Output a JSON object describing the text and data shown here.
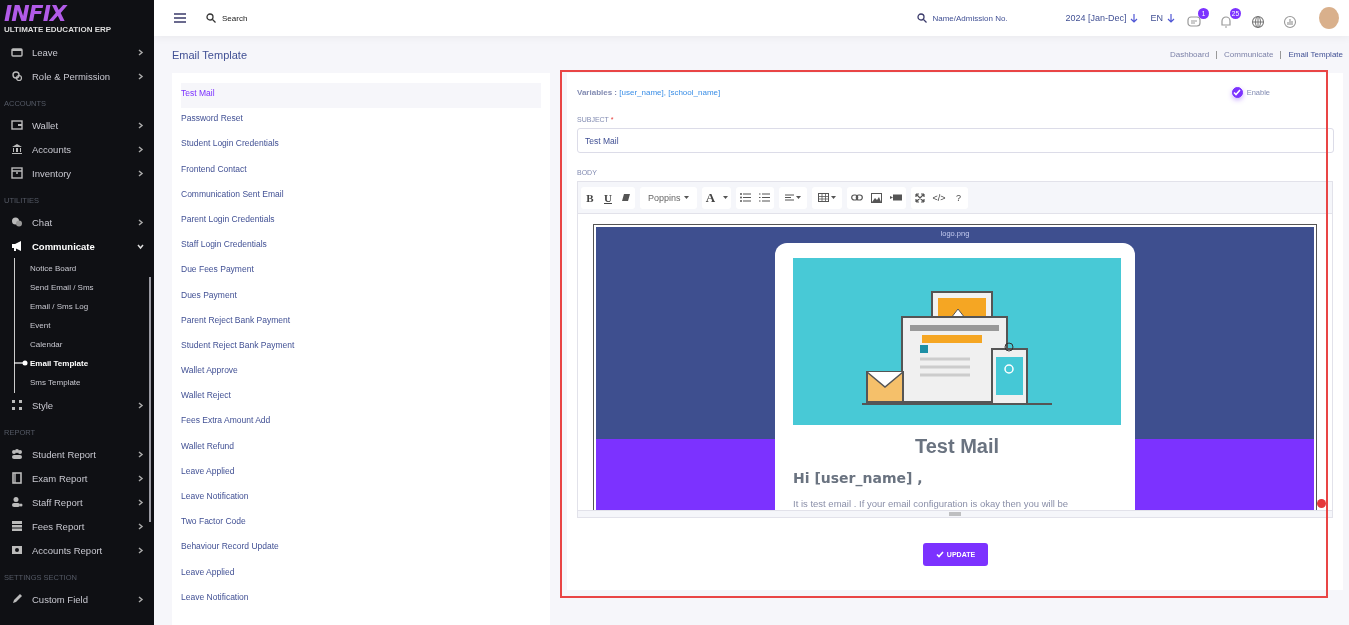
{
  "sidebar": {
    "logo": {
      "title": "INFIX",
      "subtitle": "ULTIMATE EDUCATION ERP"
    },
    "items": [
      {
        "kind": "item",
        "label": "Leave",
        "expanded": false
      },
      {
        "kind": "item",
        "label": "Role & Permission",
        "expanded": false
      },
      {
        "kind": "section",
        "label": "ACCOUNTS"
      },
      {
        "kind": "item",
        "label": "Wallet",
        "expanded": false
      },
      {
        "kind": "item",
        "label": "Accounts",
        "expanded": false
      },
      {
        "kind": "item",
        "label": "Inventory",
        "expanded": false
      },
      {
        "kind": "section",
        "label": "UTILITIES"
      },
      {
        "kind": "item",
        "label": "Chat",
        "expanded": false
      },
      {
        "kind": "item",
        "label": "Communicate",
        "expanded": true,
        "children": [
          {
            "label": "Notice Board",
            "selected": false
          },
          {
            "label": "Send Email / Sms",
            "selected": false
          },
          {
            "label": "Email / Sms Log",
            "selected": false
          },
          {
            "label": "Event",
            "selected": false
          },
          {
            "label": "Calendar",
            "selected": false
          },
          {
            "label": "Email Template",
            "selected": true
          },
          {
            "label": "Sms Template",
            "selected": false
          }
        ]
      },
      {
        "kind": "item",
        "label": "Style",
        "expanded": false
      },
      {
        "kind": "section",
        "label": "REPORT"
      },
      {
        "kind": "item",
        "label": "Student Report",
        "expanded": false
      },
      {
        "kind": "item",
        "label": "Exam Report",
        "expanded": false
      },
      {
        "kind": "item",
        "label": "Staff Report",
        "expanded": false
      },
      {
        "kind": "item",
        "label": "Fees Report",
        "expanded": false
      },
      {
        "kind": "item",
        "label": "Accounts Report",
        "expanded": false
      },
      {
        "kind": "section",
        "label": "SETTINGS SECTION"
      },
      {
        "kind": "item",
        "label": "Custom Field",
        "expanded": false
      }
    ]
  },
  "topbar": {
    "search": {
      "placeholder": "Search"
    },
    "student_search": {
      "placeholder": "Name/Admission No."
    },
    "session": "2024 [Jan-Dec]",
    "language": "EN",
    "message_count": "1",
    "notification_count": "25"
  },
  "page_title": "Email Template",
  "breadcrumb": [
    "Dashboard",
    "Communicate",
    "Email Template"
  ],
  "templates": [
    {
      "label": "Test Mail",
      "selected": true
    },
    {
      "label": "Password Reset",
      "selected": false
    },
    {
      "label": "Student Login Credentials",
      "selected": false
    },
    {
      "label": "Frontend Contact",
      "selected": false
    },
    {
      "label": "Communication Sent Email",
      "selected": false
    },
    {
      "label": "Parent Login Credentials",
      "selected": false
    },
    {
      "label": "Staff Login Credentials",
      "selected": false
    },
    {
      "label": "Due Fees Payment",
      "selected": false
    },
    {
      "label": "Dues Payment",
      "selected": false
    },
    {
      "label": "Parent Reject Bank Payment",
      "selected": false
    },
    {
      "label": "Student Reject Bank Payment",
      "selected": false
    },
    {
      "label": "Wallet Approve",
      "selected": false
    },
    {
      "label": "Wallet Reject",
      "selected": false
    },
    {
      "label": "Fees Extra Amount Add",
      "selected": false
    },
    {
      "label": "Wallet Refund",
      "selected": false
    },
    {
      "label": "Leave Applied",
      "selected": false
    },
    {
      "label": "Leave Notification",
      "selected": false
    },
    {
      "label": "Two Factor Code",
      "selected": false
    },
    {
      "label": "Behaviour Record Update",
      "selected": false
    },
    {
      "label": "Leave Applied",
      "selected": false
    },
    {
      "label": "Leave Notification",
      "selected": false
    }
  ],
  "form": {
    "variables_label": "Variables :",
    "variables": "[user_name], [school_name]",
    "enable": {
      "label": "Enable",
      "checked": true
    },
    "subject_label": "SUBJECT",
    "required_mark": "*",
    "subject": "Test Mail",
    "body_label": "BODY",
    "toolbar": [
      [
        {
          "kind": "text",
          "label": "B"
        },
        {
          "kind": "text",
          "label": "U"
        },
        {
          "kind": "icon"
        }
      ],
      [
        {
          "kind": "dropdown",
          "label": "Poppins"
        }
      ],
      [
        {
          "kind": "text",
          "label": "A"
        },
        {
          "kind": "caret"
        }
      ],
      [
        {
          "kind": "icon"
        },
        {
          "kind": "icon"
        }
      ],
      [
        {
          "kind": "icondrop"
        }
      ],
      [
        {
          "kind": "icondrop"
        }
      ],
      [
        {
          "kind": "icon"
        },
        {
          "kind": "icon"
        },
        {
          "kind": "icon"
        }
      ],
      [
        {
          "kind": "icon"
        },
        {
          "kind": "text",
          "label": "</>"
        },
        {
          "kind": "text",
          "label": "?"
        }
      ]
    ],
    "preview": {
      "logo_alt": "logo.png",
      "heading": "Test Mail",
      "greeting": "Hi [user_name] ,",
      "body": "It is test email . If your email configuration is okay then you will be"
    },
    "button": "UPDATE"
  }
}
